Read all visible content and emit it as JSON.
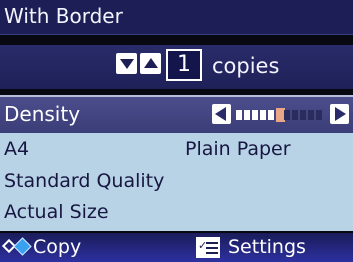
{
  "header": {
    "title": "With Border"
  },
  "copies": {
    "value": "1",
    "label": "copies"
  },
  "density": {
    "label": "Density",
    "level": 6,
    "max_level": 11
  },
  "info": {
    "paper_size": "A4",
    "paper_type": "Plain Paper",
    "quality": "Standard Quality",
    "reduce_enlarge": "Actual Size"
  },
  "footer": {
    "copy_label": "Copy",
    "settings_label": "Settings"
  },
  "icons": {
    "copy": "copy-diamonds-icon",
    "settings": "checklist-icon",
    "decrement": "triangle-down-icon",
    "increment": "triangle-up-icon",
    "left": "triangle-left-icon",
    "right": "triangle-right-icon"
  },
  "colors": {
    "header_bg": "#1d1e55",
    "info_panel_bg": "#b9d3e6",
    "density_current": "#e8a888",
    "footer_bg": "#2d30a0"
  }
}
